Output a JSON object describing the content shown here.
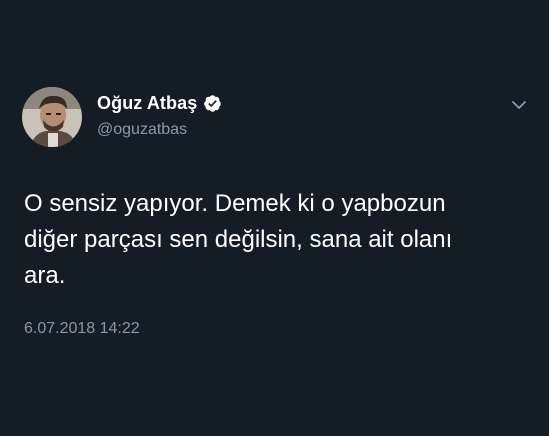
{
  "tweet": {
    "author": {
      "name": "Oğuz Atbaş",
      "handle": "@oguzatbas",
      "verified": true,
      "avatar_icon": "profile-photo"
    },
    "text_lines": [
      "O sensiz yapıyor. Demek ki o yapbozun",
      "diğer parçası sen değilsin, sana ait olanı",
      "ara."
    ],
    "timestamp": "6.07.2018 14:22",
    "menu_icon": "chevron-down-icon"
  },
  "colors": {
    "background": "#141d26",
    "text_primary": "#ffffff",
    "text_secondary": "#8899a6",
    "verified_badge": "#ffffff"
  }
}
